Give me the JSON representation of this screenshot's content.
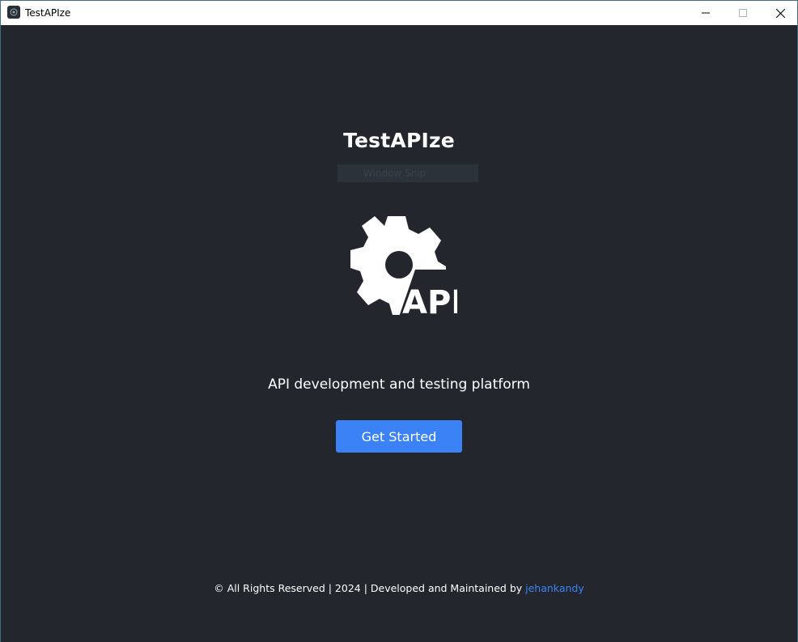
{
  "window": {
    "title": "TestAPIze",
    "controls": {
      "minimize": "minimize",
      "maximize": "maximize",
      "close": "close"
    }
  },
  "main": {
    "app_title": "TestAPIze",
    "snip_overlay": "Window Snip",
    "logo_text": "API",
    "tagline": "API development and testing platform",
    "cta_label": "Get Started"
  },
  "footer": {
    "text": "© All Rights Reserved | 2024 | Developed and Maintained by ",
    "author_link": "jehankandy"
  },
  "colors": {
    "background": "#23272d",
    "accent": "#3b82f6",
    "text": "#ffffff",
    "titlebar": "#ffffff"
  },
  "icons": [
    "app-icon",
    "gear-api-logo-icon",
    "minimize-icon",
    "maximize-icon",
    "close-icon"
  ]
}
